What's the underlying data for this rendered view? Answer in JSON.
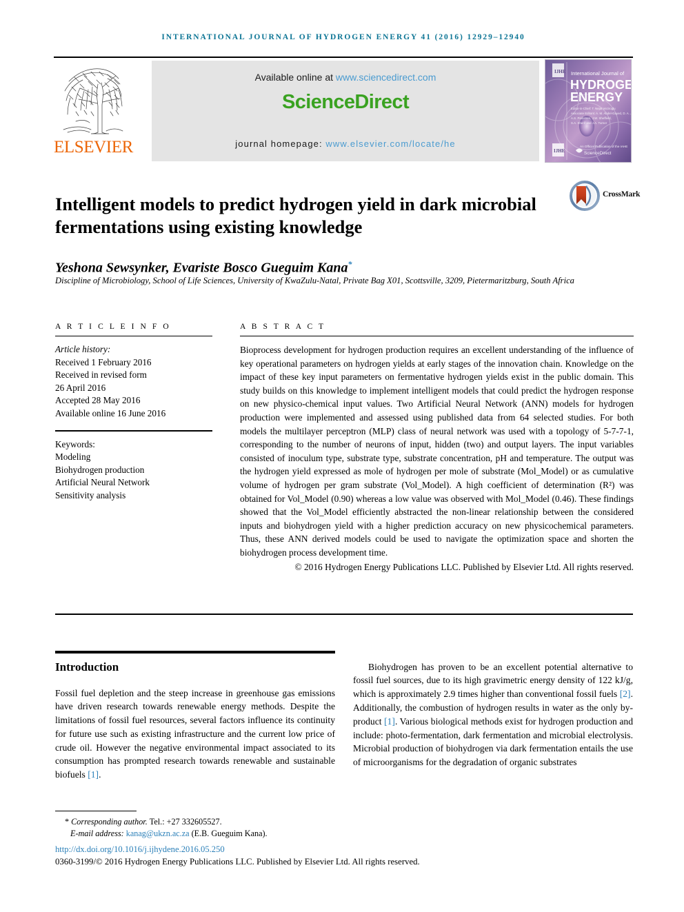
{
  "running_head": "International Journal of Hydrogen Energy 41 (2016) 12929–12940",
  "masthead": {
    "publisher_name": "ELSEVIER",
    "publisher_logo_icon": "elsevier-tree-icon",
    "available_online_label": "Available online at",
    "sciencedirect_url": "www.sciencedirect.com",
    "sciencedirect_wordmark": "ScienceDirect",
    "homepage_label": "journal homepage:",
    "homepage_url": "www.elsevier.com/locate/he",
    "cover": {
      "kicker": "International Journal of",
      "line1": "HYDROGEN",
      "line2": "ENERGY",
      "footer_brand": "ScienceDirect",
      "corner_badge": "IJHE"
    },
    "colors": {
      "banner_bg": "#e4e4e4",
      "sciencedirect_green": "#3aa221",
      "link_blue": "#4a9bd0",
      "elsevier_orange": "#ec6608",
      "running_head_teal": "#0b7494"
    }
  },
  "article": {
    "title": "Intelligent models to predict hydrogen yield in dark microbial fermentations using existing knowledge",
    "crossmark_label": "CrossMark",
    "crossmark_icon": "crossmark-icon",
    "authors": "Yeshona Sewsynker, Evariste Bosco Gueguim Kana",
    "corresponding_marker": "*",
    "affiliation": "Discipline of Microbiology, School of Life Sciences, University of KwaZulu-Natal, Private Bag X01, Scottsville, 3209, Pietermaritzburg, South Africa"
  },
  "article_info": {
    "section_label": "A R T I C L E   I N F O",
    "history_label": "Article history:",
    "history": [
      "Received 1 February 2016",
      "Received in revised form",
      "26 April 2016",
      "Accepted 28 May 2016",
      "Available online 16 June 2016"
    ],
    "keywords_label": "Keywords:",
    "keywords": [
      "Modeling",
      "Biohydrogen production",
      "Artificial Neural Network",
      "Sensitivity analysis"
    ]
  },
  "abstract": {
    "section_label": "A B S T R A C T",
    "body": "Bioprocess development for hydrogen production requires an excellent understanding of the influence of key operational parameters on hydrogen yields at early stages of the innovation chain. Knowledge on the impact of these key input parameters on fermentative hydrogen yields exist in the public domain. This study builds on this knowledge to implement intelligent models that could predict the hydrogen response on new physico-chemical input values. Two Artificial Neural Network (ANN) models for hydrogen production were implemented and assessed using published data from 64 selected studies. For both models the multilayer perceptron (MLP) class of neural network was used with a topology of 5-7-7-1, corresponding to the number of neurons of input, hidden (two) and output layers. The input variables consisted of inoculum type, substrate type, substrate concentration, pH and temperature. The output was the hydrogen yield expressed as mole of hydrogen per mole of substrate (Mol_Model) or as cumulative volume of hydrogen per gram substrate (Vol_Model). A high coefficient of determination (R²) was obtained for Vol_Model (0.90) whereas a low value was observed with Mol_Model (0.46). These findings showed that the Vol_Model efficiently abstracted the non-linear relationship between the considered inputs and biohydrogen yield with a higher prediction accuracy on new physicochemical parameters. Thus, these ANN derived models could be used to navigate the optimization space and shorten the biohydrogen process development time.",
    "copyright": "© 2016 Hydrogen Energy Publications LLC. Published by Elsevier Ltd. All rights reserved."
  },
  "introduction": {
    "heading": "Introduction",
    "left_paragraph": "Fossil fuel depletion and the steep increase in greenhouse gas emissions have driven research towards renewable energy methods. Despite the limitations of fossil fuel resources, several factors influence its continuity for future use such as existing infrastructure and the current low price of crude oil. However the negative environmental impact associated to its consumption has prompted research towards renewable and sustainable biofuels ",
    "left_ref": "[1]",
    "left_tail": ".",
    "right_p1": "Biohydrogen has proven to be an excellent potential alternative to fossil fuel sources, due to its high gravimetric energy density of 122 kJ/g, which is approximately 2.9 times higher than conventional fossil fuels ",
    "right_ref1": "[2]",
    "right_p2": ". Additionally, the combustion of hydrogen results in water as the only by-product ",
    "right_ref2": "[1]",
    "right_p3": ". Various biological methods exist for hydrogen production and include: photo-fermentation, dark fermentation and microbial electrolysis. Microbial production of biohydrogen via dark fermentation entails the use of microorganisms for the degradation of organic substrates"
  },
  "footer": {
    "corresponding_marker": "*",
    "corresponding_label": "Corresponding author.",
    "tel": "Tel.: +27 332605527.",
    "email_label": "E-mail address:",
    "email": "kanag@ukzn.ac.za",
    "email_attribution": "(E.B. Gueguim Kana).",
    "doi": "http://dx.doi.org/10.1016/j.ijhydene.2016.05.250",
    "issn_line": "0360-3199/© 2016 Hydrogen Energy Publications LLC. Published by Elsevier Ltd. All rights reserved."
  }
}
